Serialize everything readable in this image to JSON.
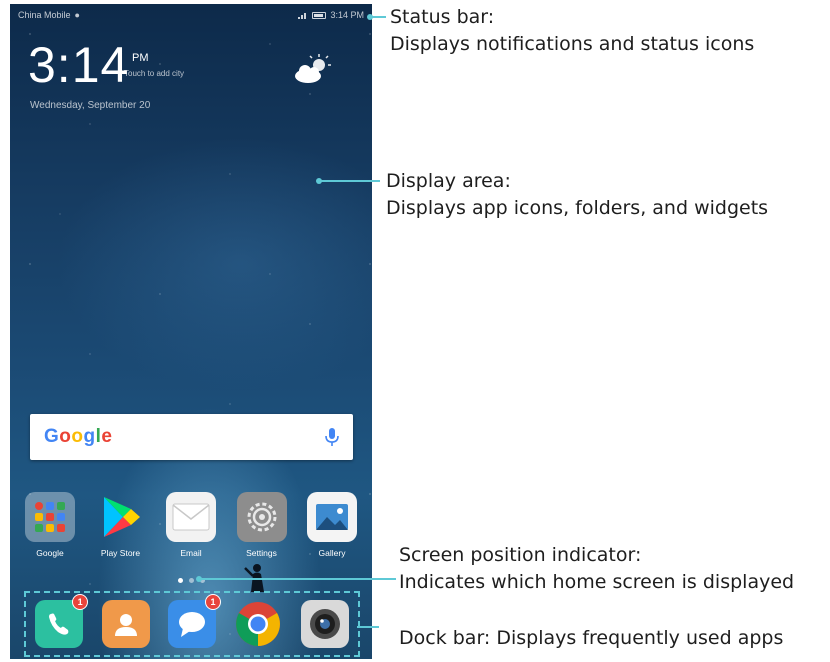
{
  "status_bar": {
    "carrier": "China Mobile",
    "time": "3:14 PM"
  },
  "lock_widget": {
    "clock": "3:14",
    "ampm": "PM",
    "add_city": "Touch to add city",
    "date": "Wednesday, September 20"
  },
  "search": {
    "logo": "Google"
  },
  "apps": [
    {
      "label": "Google",
      "icon": "google-folder-icon"
    },
    {
      "label": "Play Store",
      "icon": "play-store-icon"
    },
    {
      "label": "Email",
      "icon": "email-icon"
    },
    {
      "label": "Settings",
      "icon": "settings-icon"
    },
    {
      "label": "Gallery",
      "icon": "gallery-icon"
    }
  ],
  "page_indicator": {
    "pages": 3,
    "active": 1
  },
  "dock": [
    {
      "icon": "phone-icon",
      "badge": "1"
    },
    {
      "icon": "contacts-icon",
      "badge": ""
    },
    {
      "icon": "messages-icon",
      "badge": "1"
    },
    {
      "icon": "chrome-icon",
      "badge": ""
    },
    {
      "icon": "camera-icon",
      "badge": ""
    }
  ],
  "callouts": {
    "status_bar": {
      "title": "Status bar:",
      "desc": "Displays notifications and status icons"
    },
    "display_area": {
      "title": "Display area:",
      "desc": "Displays app icons, folders, and widgets"
    },
    "screen_indicator": {
      "title": "Screen position indicator:",
      "desc": "Indicates which home screen is displayed"
    },
    "dock_bar": {
      "text": "Dock bar: Displays frequently used apps"
    }
  },
  "colors": {
    "callout_accent": "#5ec9d6",
    "badge": "#e8453c"
  }
}
